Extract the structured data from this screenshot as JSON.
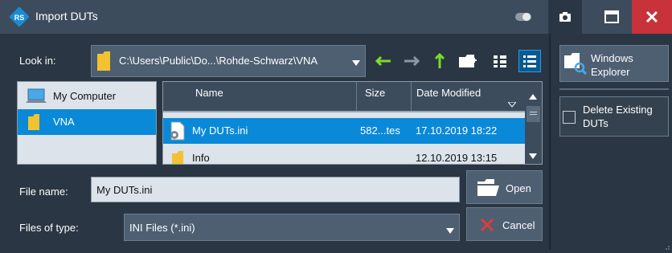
{
  "window": {
    "title": "Import DUTs",
    "icons": {
      "logo": "rohde-schwarz-logo-icon",
      "toggle": "toggle-icon",
      "camera": "camera-icon",
      "maximize": "maximize-icon",
      "close": "close-icon"
    }
  },
  "look_in": {
    "label": "Look in:",
    "path": "C:\\Users\\Public\\Do...\\Rohde-Schwarz\\VNA",
    "toolbar_icons": [
      "back-arrow-icon",
      "forward-arrow-icon",
      "up-arrow-icon",
      "new-folder-icon",
      "list-view-icon",
      "details-view-icon"
    ]
  },
  "places": [
    {
      "label": "My Computer",
      "icon": "computer-icon",
      "selected": false
    },
    {
      "label": "VNA",
      "icon": "folder-icon",
      "selected": true
    }
  ],
  "file_list": {
    "columns": [
      "Name",
      "Size",
      "Date Modified"
    ],
    "rows": [
      {
        "name": "My DUTs.ini",
        "size": "582...tes",
        "date": "17.10.2019 18:22",
        "icon": "ini-file-icon",
        "selected": true
      },
      {
        "name": "Info",
        "size": "",
        "date": "12.10.2019 13:15",
        "icon": "folder-icon",
        "selected": false
      }
    ]
  },
  "file_name": {
    "label": "File name:",
    "value": "My DUTs.ini"
  },
  "files_of_type": {
    "label": "Files of type:",
    "value": "INI Files (*.ini)"
  },
  "buttons": {
    "open": "Open",
    "cancel": "Cancel"
  },
  "side": {
    "windows_explorer": [
      "Windows",
      "Explorer"
    ],
    "delete_existing": [
      "Delete Existing",
      "DUTs"
    ],
    "delete_existing_checked": false
  },
  "colors": {
    "background": "#2a3643",
    "titlebar": "#3d4c5d",
    "selection": "#0a89d8",
    "close": "#c8323a",
    "arrow_green": "#7bdc2a"
  }
}
